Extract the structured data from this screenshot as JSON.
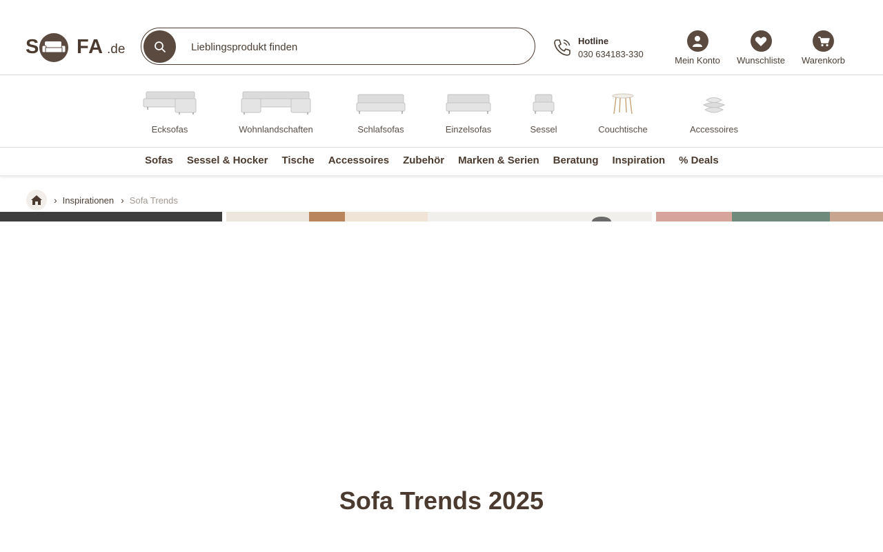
{
  "logo": {
    "part1": "S",
    "part2": "FA",
    "suffix": ".de"
  },
  "search": {
    "placeholder": "Lieblingsprodukt finden"
  },
  "hotline": {
    "label": "Hotline",
    "number": "030 634183-330"
  },
  "header_icons": [
    {
      "label": "Mein Konto",
      "icon": "user-icon"
    },
    {
      "label": "Wunschliste",
      "icon": "heart-icon"
    },
    {
      "label": "Warenkorb",
      "icon": "cart-icon"
    }
  ],
  "categories": [
    {
      "label": "Ecksofas",
      "icon": "corner-sofa-icon"
    },
    {
      "label": "Wohnlandschaften",
      "icon": "sectional-sofa-icon"
    },
    {
      "label": "Schlafsofas",
      "icon": "sofa-bed-icon"
    },
    {
      "label": "Einzelsofas",
      "icon": "single-sofa-icon"
    },
    {
      "label": "Sessel",
      "icon": "armchair-icon"
    },
    {
      "label": "Couchtische",
      "icon": "coffee-table-icon"
    },
    {
      "label": "Accessoires",
      "icon": "cushions-icon"
    }
  ],
  "nav": [
    "Sofas",
    "Sessel & Hocker",
    "Tische",
    "Accessoires",
    "Zubehör",
    "Marken & Serien",
    "Beratung",
    "Inspiration",
    "% Deals"
  ],
  "breadcrumb": {
    "level1": "Inspirationen",
    "current": "Sofa Trends"
  },
  "colors": {
    "brand": "#5b4a3f",
    "text": "#4a3d33",
    "muted": "#a29891",
    "sofa": "#d9d9d9"
  },
  "page": {
    "title": "Sofa Trends 2025"
  }
}
